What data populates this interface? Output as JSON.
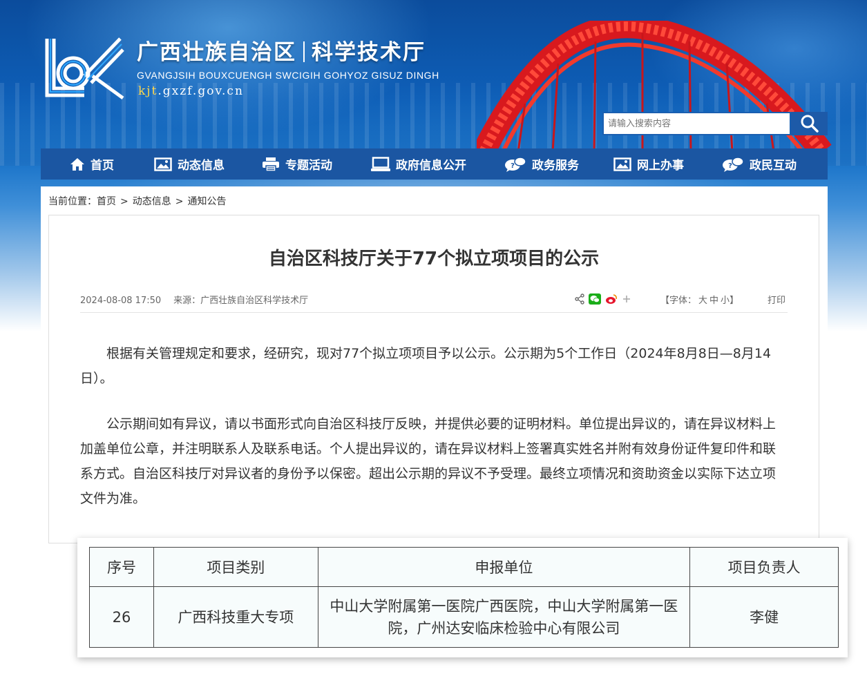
{
  "site": {
    "name_region": "广西壮族自治区",
    "name_dept": "科学技术厅",
    "name_en": "GVANGJSIH BOUXCUENGH SWCIGIH GOHYOZ GISUZ DINGH",
    "domain_prefix": "kjt",
    "domain_suffix": ".gxzf.gov.cn"
  },
  "search": {
    "placeholder": "请输入搜索内容"
  },
  "nav": {
    "items": [
      {
        "label": "首页",
        "icon": "home-icon"
      },
      {
        "label": "动态信息",
        "icon": "picture-icon"
      },
      {
        "label": "专题活动",
        "icon": "printer-icon"
      },
      {
        "label": "政府信息公开",
        "icon": "monitor-icon"
      },
      {
        "label": "政务服务",
        "icon": "chat-bubble-icon"
      },
      {
        "label": "网上办事",
        "icon": "picture-icon"
      },
      {
        "label": "政民互动",
        "icon": "chat-bubble-icon"
      }
    ]
  },
  "breadcrumb": {
    "prefix": "当前位置：",
    "items": [
      "首页",
      "动态信息",
      "通知公告"
    ],
    "sep": ">"
  },
  "article": {
    "title": "自治区科技厅关于77个拟立项项目的公示",
    "datetime": "2024-08-08 17:50",
    "source": "来源：广西壮族自治区科学技术厅",
    "font_label": "【字体：",
    "font_options": [
      "大",
      "中",
      "小"
    ],
    "font_close": "】",
    "print_label": "打印",
    "paragraphs": [
      "根据有关管理规定和要求，经研究，现对77个拟立项项目予以公示。公示期为5个工作日（2024年8月8日—8月14日）。",
      "公示期间如有异议，请以书面形式向自治区科技厅反映，并提供必要的证明材料。单位提出异议的，请在异议材料上加盖单位公章，并注明联系人及联系电话。个人提出异议的，请在异议材料上签署真实姓名并附有效身份证件复印件和联系方式。自治区科技厅对异议者的身份予以保密。超出公示期的异议不予受理。最终立项情况和资助资金以实际下达立项文件为准。"
    ]
  },
  "table": {
    "headers": [
      "序号",
      "项目类别",
      "申报单位",
      "项目负责人"
    ],
    "rows": [
      [
        "26",
        "广西科技重大专项",
        "中山大学附属第一医院广西医院，中山大学附属第一医院，广州达安临床检验中心有限公司",
        "李健"
      ]
    ]
  },
  "colors": {
    "nav_bg": "#1b56a2",
    "search_btn": "#1d5aa8",
    "domain_highlight": "#ffd84a",
    "wechat_green": "#1aad19",
    "weibo_red": "#e6162d"
  }
}
